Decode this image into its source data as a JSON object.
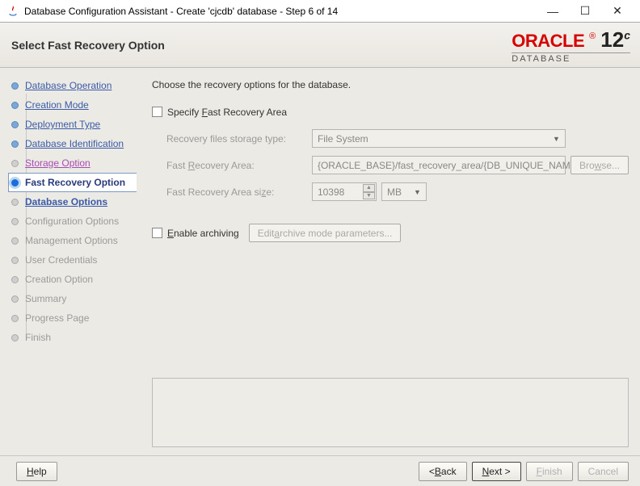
{
  "window": {
    "title": "Database Configuration Assistant - Create 'cjcdb' database - Step 6 of 14"
  },
  "header": {
    "title": "Select Fast Recovery Option",
    "brand": "ORACLE",
    "brand_sub": "DATABASE",
    "version": "12",
    "version_sup": "c"
  },
  "sidebar": {
    "items": [
      {
        "label": "Database Operation",
        "state": "visited"
      },
      {
        "label": "Creation Mode",
        "state": "visited"
      },
      {
        "label": "Deployment Type",
        "state": "visited"
      },
      {
        "label": "Database Identification",
        "state": "visited"
      },
      {
        "label": "Storage Option",
        "state": "prev"
      },
      {
        "label": "Fast Recovery Option",
        "state": "current"
      },
      {
        "label": "Database Options",
        "state": "next"
      },
      {
        "label": "Configuration Options",
        "state": "future"
      },
      {
        "label": "Management Options",
        "state": "future"
      },
      {
        "label": "User Credentials",
        "state": "future"
      },
      {
        "label": "Creation Option",
        "state": "future"
      },
      {
        "label": "Summary",
        "state": "future"
      },
      {
        "label": "Progress Page",
        "state": "future"
      },
      {
        "label": "Finish",
        "state": "future"
      }
    ]
  },
  "main": {
    "intro": "Choose the recovery options for the database.",
    "specify_label": "Specify Fast Recovery Area",
    "storage_type_label": "Recovery files storage type:",
    "storage_type_value": "File System",
    "area_label": "Fast Recovery Area:",
    "area_value": "{ORACLE_BASE}/fast_recovery_area/{DB_UNIQUE_NAME}",
    "browse": "Browse...",
    "size_label": "Fast Recovery Area size:",
    "size_value": "10398",
    "size_unit": "MB",
    "archiving_label": "Enable archiving",
    "archive_params": "Edit archive mode parameters..."
  },
  "footer": {
    "help": "Help",
    "back": "< Back",
    "next": "Next >",
    "finish": "Finish",
    "cancel": "Cancel"
  }
}
